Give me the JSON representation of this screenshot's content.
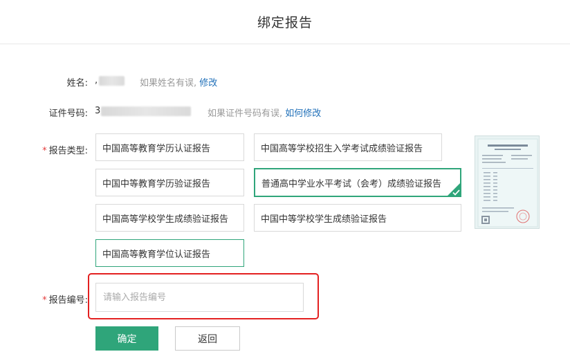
{
  "header": {
    "title": "绑定报告"
  },
  "form": {
    "name": {
      "label": "姓名:",
      "value_prefix": ",",
      "hint": "如果姓名有误,",
      "link": "修改"
    },
    "id_number": {
      "label": "证件号码:",
      "value_prefix": "3",
      "hint": "如果证件号码有误,",
      "link": "如何修改"
    },
    "report_type": {
      "required_mark": "*",
      "label": "报告类型:",
      "options": [
        "中国高等教育学历认证报告",
        "中国高等学校招生入学考试成绩验证报告",
        "中国中等教育学历验证报告",
        "普通高中学业水平考试（会考）成绩验证报告",
        "中国高等学校学生成绩验证报告",
        "中国中等学校学生成绩验证报告",
        "中国高等教育学位认证报告"
      ],
      "selected_index": 3
    },
    "report_number": {
      "required_mark": "*",
      "label": "报告编号:",
      "placeholder": "请输入报告编号",
      "value": ""
    }
  },
  "actions": {
    "confirm_label": "确定",
    "back_label": "返回"
  },
  "colors": {
    "accent": "#2fa57a",
    "link": "#1f6fb8",
    "required": "#e33b3b",
    "highlight_box": "#e32020"
  },
  "icons": {
    "selected_check": "check-icon",
    "sample_report": "report-sample-thumbnail"
  }
}
